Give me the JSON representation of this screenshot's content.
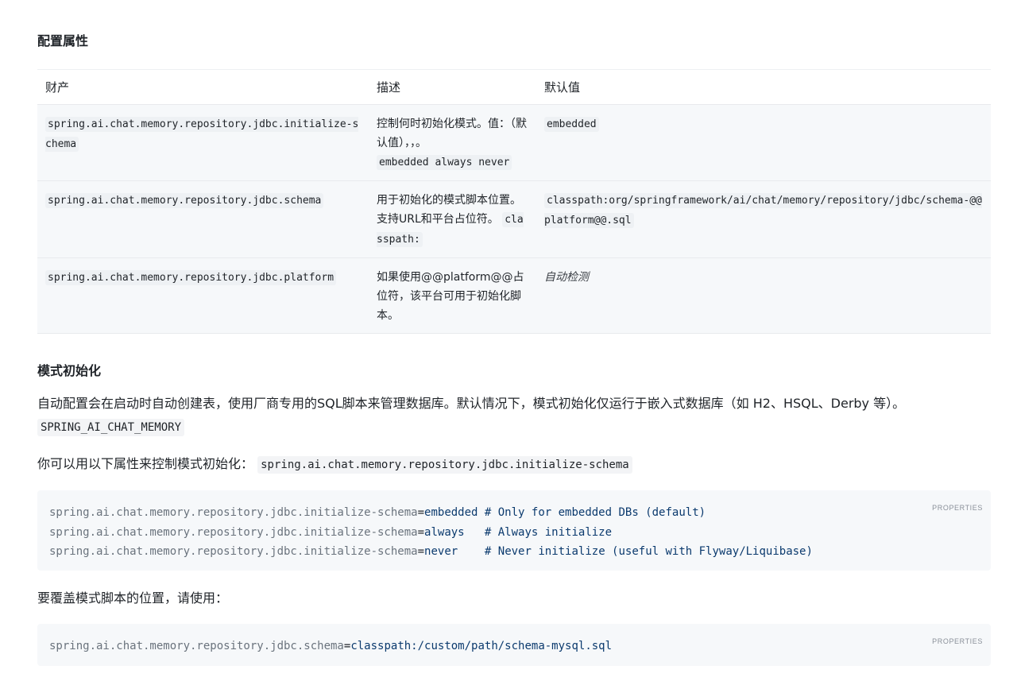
{
  "sections": {
    "config_title": "配置属性",
    "schema_init_title": "模式初始化"
  },
  "table": {
    "headers": [
      "财产",
      "描述",
      "默认值"
    ],
    "rows": [
      {
        "property": "spring.ai.chat.memory.repository.jdbc.initialize-schema",
        "description_text": "控制何时初始化模式。值：（默认值），，。",
        "description_code": "embedded always never",
        "default_code": "embedded"
      },
      {
        "property": "spring.ai.chat.memory.repository.jdbc.schema",
        "description_text": "用于初始化的模式脚本位置。支持URL和平台占位符。",
        "description_code": "classpath:",
        "default_code": "classpath:org/springframework/ai/chat/memory/repository/jdbc/schema-@@platform@@.sql"
      },
      {
        "property": "spring.ai.chat.memory.repository.jdbc.platform",
        "description_text": "如果使用@@platform@@占位符，该平台可用于初始化脚本。",
        "default_em": "自动检测"
      }
    ]
  },
  "paragraphs": {
    "p1_text": "自动配置会在启动时自动创建表，使用厂商专用的SQL脚本来管理数据库。默认情况下，模式初始化仅运行于嵌入式数据库（如 H2、HSQL、Derby 等）。",
    "p1_code": "SPRING_AI_CHAT_MEMORY",
    "p2_text": "你可以用以下属性来控制模式初始化：",
    "p2_code": "spring.ai.chat.memory.repository.jdbc.initialize-schema",
    "p3_text": "要覆盖模式脚本的位置，请使用："
  },
  "code_blocks": [
    {
      "lang": "PROPERTIES",
      "lines": [
        {
          "key": "spring.ai.chat.memory.repository.jdbc.initialize-schema",
          "eq": "=",
          "value": "embedded",
          "comment": " # Only for embedded DBs (default)"
        },
        {
          "key": "spring.ai.chat.memory.repository.jdbc.initialize-schema",
          "eq": "=",
          "value": "always",
          "comment": "   # Always initialize"
        },
        {
          "key": "spring.ai.chat.memory.repository.jdbc.initialize-schema",
          "eq": "=",
          "value": "never",
          "comment": "    # Never initialize (useful with Flyway/Liquibase)"
        }
      ]
    },
    {
      "lang": "PROPERTIES",
      "lines": [
        {
          "key": "spring.ai.chat.memory.repository.jdbc.schema",
          "eq": "=",
          "value": "classpath:/custom/path/schema-mysql.sql",
          "comment": ""
        }
      ]
    }
  ]
}
